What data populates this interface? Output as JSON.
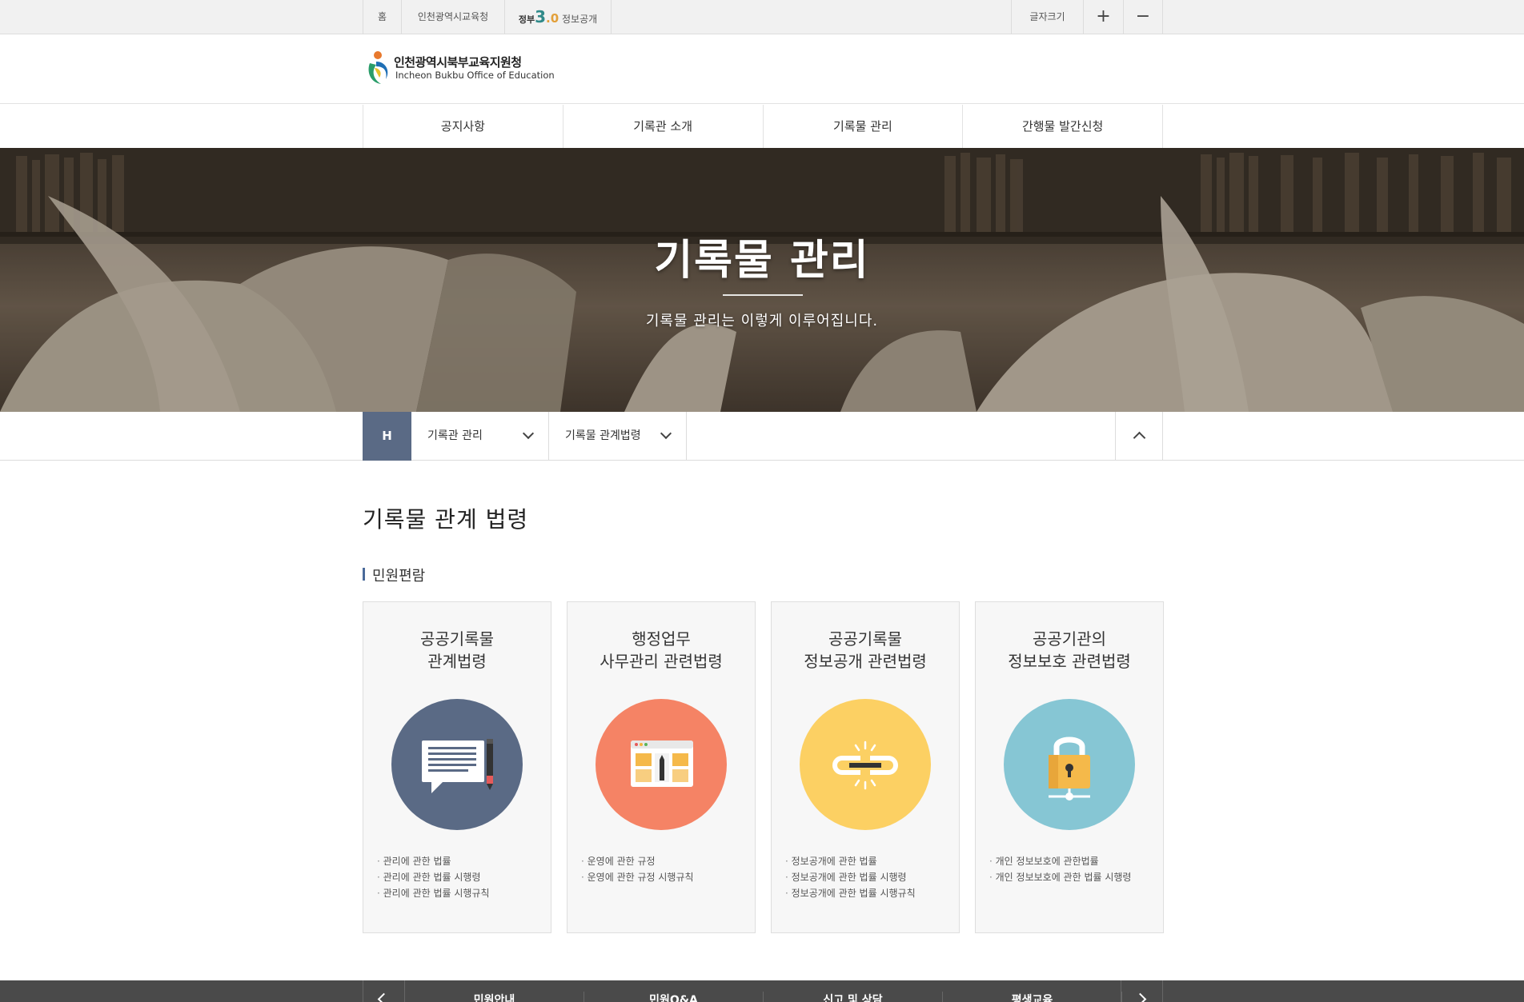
{
  "topbar": {
    "home": "홈",
    "office": "인천광역시교육청",
    "gov_prefix": "정부",
    "gov_three": "3",
    "gov_zero": ".0",
    "gov_label": "정보공개",
    "font_size_label": "글자크기",
    "plus": "+",
    "minus": "−"
  },
  "logo": {
    "ko": "인천광역시북부교육지원청",
    "en": "Incheon Bukbu Office of Education"
  },
  "gnb": [
    "공지사항",
    "기록관 소개",
    "기록물 관리",
    "간행물 발간신청"
  ],
  "hero": {
    "title": "기록물 관리",
    "subtitle": "기록물 관리는 이렇게 이루어집니다."
  },
  "location": {
    "home": "H",
    "level1": "기록관 관리",
    "level2": "기록물 관계법령"
  },
  "content": {
    "page_title": "기록물 관계 법령",
    "section_title": "민원편람",
    "cards": [
      {
        "title_line1": "공공기록물",
        "title_line2": "관계법령",
        "color": "#5a6a85",
        "icon": "document-pen-icon",
        "items": [
          "관리에 관한 법률",
          "관리에 관한 법률 시행령",
          "관리에 관한 법률 시행규칙"
        ]
      },
      {
        "title_line1": "행정업무",
        "title_line2": "사무관리 관련법령",
        "color": "#f58365",
        "icon": "web-layout-icon",
        "items": [
          "운영에 관한 규정",
          "운영에 관한 규정 시행규칙"
        ]
      },
      {
        "title_line1": "공공기록물",
        "title_line2": "정보공개 관련법령",
        "color": "#fcd063",
        "icon": "broken-link-icon",
        "items": [
          "정보공개에 관한 법률",
          "정보공개에 관한 법률 시행령",
          "정보공개에 관한 법률 시행규칙"
        ]
      },
      {
        "title_line1": "공공기관의",
        "title_line2": "정보보호 관련법령",
        "color": "#86c6d4",
        "icon": "padlock-icon",
        "items": [
          "개인 정보보호에 관한법률",
          "개인 정보보호에 관한 법률 시행령"
        ]
      }
    ]
  },
  "footer": {
    "items": [
      "민원안내",
      "민원Q&A",
      "신고 및 상담",
      "평생교육"
    ]
  }
}
